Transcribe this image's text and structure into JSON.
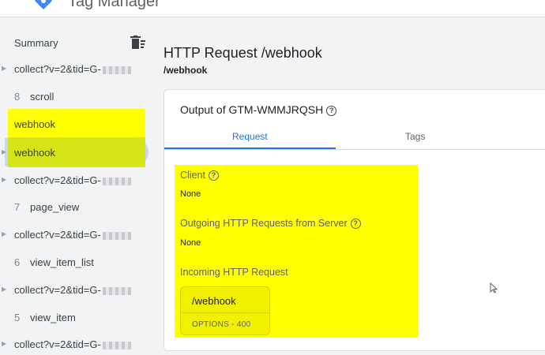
{
  "app": {
    "title": "Tag Manager"
  },
  "sidebar": {
    "summary_label": "Summary",
    "items": [
      {
        "type": "request",
        "text": "collect?v=2&tid=G-"
      },
      {
        "type": "event",
        "num": "8",
        "label": "scroll"
      },
      {
        "type": "event",
        "num": "",
        "label": "webhook"
      },
      {
        "type": "request",
        "text": "webhook"
      },
      {
        "type": "request",
        "text": "collect?v=2&tid=G-"
      },
      {
        "type": "event",
        "num": "7",
        "label": "page_view"
      },
      {
        "type": "request",
        "text": "collect?v=2&tid=G-"
      },
      {
        "type": "event",
        "num": "6",
        "label": "view_item_list"
      },
      {
        "type": "request",
        "text": "collect?v=2&tid=G-"
      },
      {
        "type": "event",
        "num": "5",
        "label": "view_item"
      },
      {
        "type": "request",
        "text": "collect?v=2&tid=G-"
      }
    ]
  },
  "main": {
    "title": "HTTP Request /webhook",
    "subtitle": "/webhook",
    "card": {
      "title": "Output of GTM-WMMJRQSH",
      "tabs": [
        {
          "label": "Request"
        },
        {
          "label": "Tags"
        }
      ],
      "client": {
        "label": "Client",
        "value": "None"
      },
      "outgoing": {
        "label": "Outgoing HTTP Requests from Server",
        "value": "None"
      },
      "incoming": {
        "label": "Incoming HTTP Request",
        "path": "/webhook",
        "status": "OPTIONS - 400"
      }
    }
  },
  "colors": {
    "accent": "#1a73e8",
    "highlight": "#ffff00",
    "selected": "#c9d7ea"
  }
}
